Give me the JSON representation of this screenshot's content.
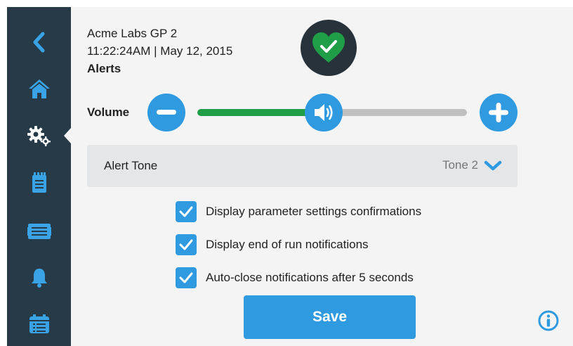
{
  "header": {
    "device_name": "Acme Labs GP 2",
    "datetime": "11:22:24AM | May 12, 2015",
    "section": "Alerts"
  },
  "status": {
    "icon": "heart-check-icon",
    "state": "ok",
    "color": "#1f9d47"
  },
  "sidebar": {
    "items": [
      {
        "icon": "back-chevron-icon",
        "active": false
      },
      {
        "icon": "home-icon",
        "active": false
      },
      {
        "icon": "gears-icon",
        "active": true
      },
      {
        "icon": "notepad-icon",
        "active": false
      },
      {
        "icon": "display-icon",
        "active": false
      },
      {
        "icon": "bell-icon",
        "active": false
      },
      {
        "icon": "calendar-list-icon",
        "active": false
      }
    ]
  },
  "volume": {
    "label": "Volume",
    "level_fraction": 0.47,
    "decrease_icon": "minus-icon",
    "increase_icon": "plus-icon",
    "knob_icon": "speaker-icon"
  },
  "alert_tone": {
    "label": "Alert Tone",
    "value": "Tone 2",
    "icon": "chevron-down-icon"
  },
  "options": [
    {
      "label": "Display parameter settings confirmations",
      "checked": true
    },
    {
      "label": "Display end of run notifications",
      "checked": true
    },
    {
      "label": "Auto-close notifications after 5 seconds",
      "checked": true
    }
  ],
  "save_label": "Save",
  "info_icon": "info-icon",
  "colors": {
    "sidebar": "#263a47",
    "accent": "#2f9ae0",
    "volume_fill": "#1f9d47",
    "status_ok": "#1f9d47",
    "track": "#c0c0c0",
    "background": "#f4f4f4"
  }
}
